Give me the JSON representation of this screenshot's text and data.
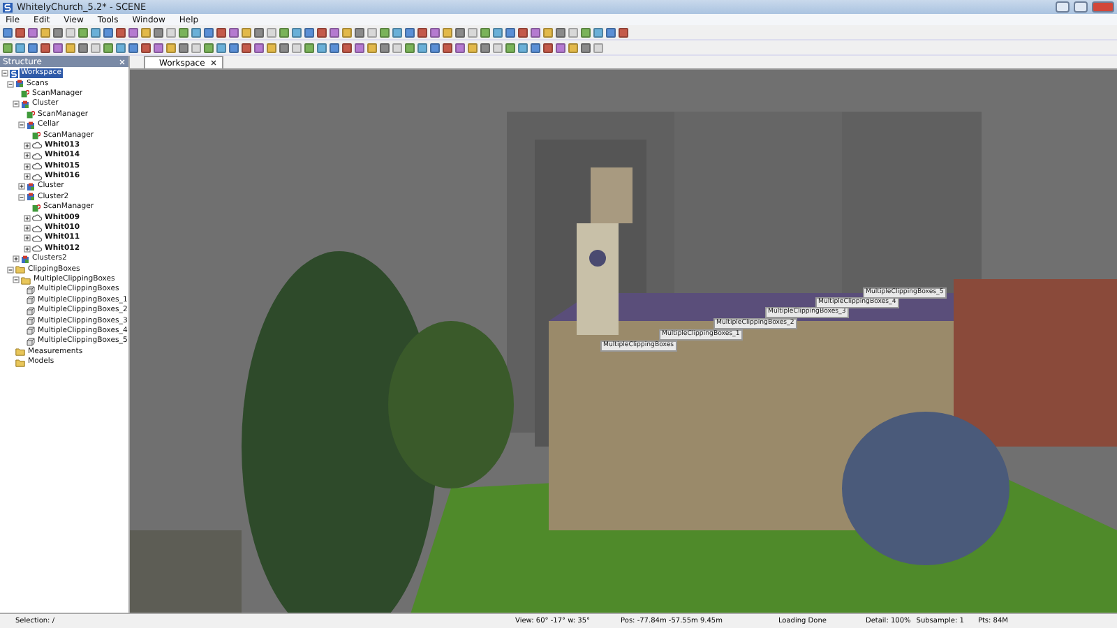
{
  "window": {
    "title": "WhitelyChurch_5.2* - SCENE"
  },
  "menu": [
    "File",
    "Edit",
    "View",
    "Tools",
    "Window",
    "Help"
  ],
  "structure_panel": {
    "title": "Structure",
    "tree": [
      {
        "label": "Workspace",
        "kind": "workspace",
        "selected": true,
        "expanded": true,
        "children": [
          {
            "label": "Scans",
            "kind": "cluster",
            "selected": false,
            "expanded": true,
            "children": [
              {
                "label": "ScanManager",
                "kind": "manager",
                "selected": false
              },
              {
                "label": "Cluster",
                "kind": "cluster",
                "selected": false,
                "expanded": true,
                "children": [
                  {
                    "label": "ScanManager",
                    "kind": "manager",
                    "selected": false
                  },
                  {
                    "label": "Cellar",
                    "kind": "cluster",
                    "selected": false,
                    "expanded": true,
                    "children": [
                      {
                        "label": "ScanManager",
                        "kind": "manager",
                        "selected": false
                      },
                      {
                        "label": "Whit013",
                        "kind": "scan",
                        "selected": false,
                        "expanded": false
                      },
                      {
                        "label": "Whit014",
                        "kind": "scan",
                        "selected": false,
                        "expanded": false
                      },
                      {
                        "label": "Whit015",
                        "kind": "scan",
                        "selected": false,
                        "expanded": false
                      },
                      {
                        "label": "Whit016",
                        "kind": "scan",
                        "selected": false,
                        "expanded": false
                      }
                    ]
                  },
                  {
                    "label": "Cluster",
                    "kind": "cluster",
                    "selected": false,
                    "expanded": false
                  },
                  {
                    "label": "Cluster2",
                    "kind": "cluster",
                    "selected": false,
                    "expanded": true,
                    "children": [
                      {
                        "label": "ScanManager",
                        "kind": "manager",
                        "selected": false
                      },
                      {
                        "label": "Whit009",
                        "kind": "scan",
                        "selected": false,
                        "expanded": false
                      },
                      {
                        "label": "Whit010",
                        "kind": "scan",
                        "selected": false,
                        "expanded": false
                      },
                      {
                        "label": "Whit011",
                        "kind": "scan",
                        "selected": false,
                        "expanded": false
                      },
                      {
                        "label": "Whit012",
                        "kind": "scan",
                        "selected": false,
                        "expanded": false
                      }
                    ]
                  }
                ]
              },
              {
                "label": "Clusters2",
                "kind": "cluster",
                "selected": false,
                "expanded": false
              }
            ]
          },
          {
            "label": "ClippingBoxes",
            "kind": "folder",
            "selected": false,
            "expanded": true,
            "children": [
              {
                "label": "MultipleClippingBoxes",
                "kind": "folder",
                "selected": false,
                "expanded": true,
                "children": [
                  {
                    "label": "MultipleClippingBoxes",
                    "kind": "box",
                    "selected": false
                  },
                  {
                    "label": "MultipleClippingBoxes_1",
                    "kind": "box",
                    "selected": false
                  },
                  {
                    "label": "MultipleClippingBoxes_2",
                    "kind": "box",
                    "selected": false
                  },
                  {
                    "label": "MultipleClippingBoxes_3",
                    "kind": "box",
                    "selected": false
                  },
                  {
                    "label": "MultipleClippingBoxes_4",
                    "kind": "box",
                    "selected": false
                  },
                  {
                    "label": "MultipleClippingBoxes_5",
                    "kind": "box",
                    "selected": false
                  }
                ]
              }
            ]
          },
          {
            "label": "Measurements",
            "kind": "folder",
            "selected": false
          },
          {
            "label": "Models",
            "kind": "folder",
            "selected": false
          }
        ]
      }
    ]
  },
  "workspace": {
    "tab": "Workspace",
    "box_labels": [
      "MultipleClippingBoxes",
      "MultipleClippingBoxes_1",
      "MultipleClippingBoxes_2",
      "MultipleClippingBoxes_3",
      "MultipleClippingBoxes_4",
      "MultipleClippingBoxes_5"
    ]
  },
  "status_bar": [
    "Selection: /",
    "View: 60° -17° w: 35°",
    "Pos: -77.84m -57.55m 9.45m",
    "Loading Done",
    "Detail: 100%",
    "Subsample: 1",
    "Pts: 84M"
  ]
}
